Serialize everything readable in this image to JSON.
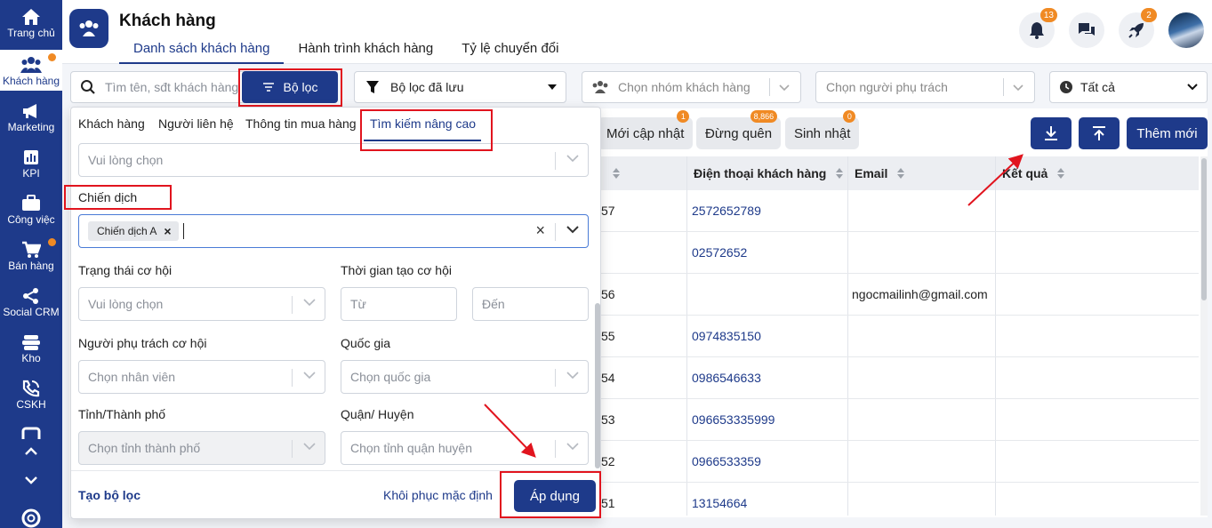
{
  "sidebar": {
    "items": [
      {
        "label": "Trang chủ",
        "icon": "home-icon"
      },
      {
        "label": "Khách hàng",
        "icon": "users-icon"
      },
      {
        "label": "Marketing",
        "icon": "megaphone-icon"
      },
      {
        "label": "KPI",
        "icon": "bar-chart-icon"
      },
      {
        "label": "Công việc",
        "icon": "briefcase-icon"
      },
      {
        "label": "Bán hàng",
        "icon": "cart-icon"
      },
      {
        "label": "Social CRM",
        "icon": "share-icon"
      },
      {
        "label": "Kho",
        "icon": "warehouse-icon"
      },
      {
        "label": "CSKH",
        "icon": "phone-icon"
      }
    ]
  },
  "header": {
    "title": "Khách hàng",
    "tabs": [
      "Danh sách khách hàng",
      "Hành trình khách hàng",
      "Tỷ lệ chuyển đổi"
    ],
    "notification_badge": "13",
    "rocket_badge": "2"
  },
  "filters": {
    "search_placeholder": "Tìm tên, sđt khách hàng",
    "filter_button": "Bộ lọc",
    "saved_filter": "Bộ lọc đã lưu",
    "customer_group_placeholder": "Chọn nhóm khách hàng",
    "owner_placeholder": "Chọn người phụ trách",
    "time_select": "Tất cả"
  },
  "chips": [
    {
      "label": "Mới cập nhật",
      "badge": "1"
    },
    {
      "label": "Đừng quên",
      "badge": "8,866"
    },
    {
      "label": "Sinh nhật",
      "badge": "0"
    }
  ],
  "actions": {
    "add_new": "Thêm mới"
  },
  "table": {
    "headers": [
      "Điện thoại khách hàng",
      "Email",
      "Kết quả"
    ],
    "rows": [
      {
        "id_tail": "57",
        "phone": "2572652789",
        "email": ""
      },
      {
        "id_tail": "",
        "phone": "02572652",
        "email": ""
      },
      {
        "id_tail": "56",
        "phone": "",
        "email": "ngocmailinh@gmail.com"
      },
      {
        "id_tail": "55",
        "phone": "0974835150",
        "email": ""
      },
      {
        "id_tail": "54",
        "phone": "0986546633",
        "email": ""
      },
      {
        "id_tail": "53",
        "phone": "096653335999",
        "email": ""
      },
      {
        "id_tail": "52",
        "phone": "0966533359",
        "email": ""
      },
      {
        "id_tail": "51",
        "phone": "13154664",
        "email": ""
      }
    ]
  },
  "panel": {
    "tabs": [
      "Khách hàng",
      "Người liên hệ",
      "Thông tin mua hàng",
      "Tìm kiếm nâng cao"
    ],
    "top_select_placeholder": "Vui lòng chọn",
    "campaign_label": "Chiến dịch",
    "campaign_tag": "Chiến dịch A",
    "opportunity_status_label": "Trạng thái cơ hội",
    "opportunity_status_placeholder": "Vui lòng chọn",
    "created_time_label": "Thời gian tạo cơ hội",
    "from_placeholder": "Từ",
    "to_placeholder": "Đến",
    "opp_owner_label": "Người phụ trách cơ hội",
    "opp_owner_placeholder": "Chọn nhân viên",
    "country_label": "Quốc gia",
    "country_placeholder": "Chọn quốc gia",
    "province_label": "Tỉnh/Thành phố",
    "province_placeholder": "Chọn tỉnh thành phố",
    "district_label": "Quận/ Huyện",
    "district_placeholder": "Chọn tỉnh quận huyện",
    "create_filter": "Tạo bộ lọc",
    "reset": "Khôi phục mặc định",
    "apply": "Áp dụng"
  },
  "colors": {
    "primary": "#1e3a8a",
    "badge": "#f08a24",
    "highlight": "#e1141e"
  }
}
